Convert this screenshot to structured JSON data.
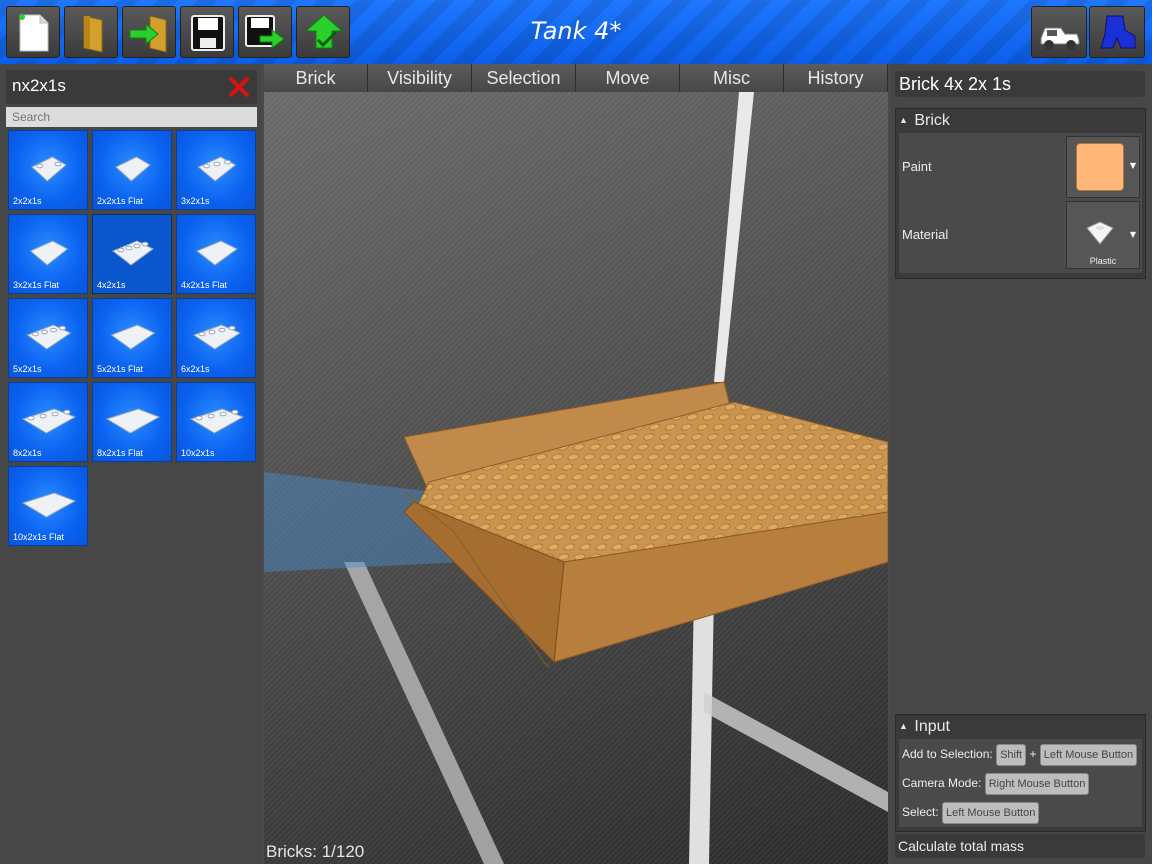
{
  "toolbar": {
    "title": "Tank 4*",
    "left_buttons": [
      "new-file-icon",
      "open-folder-icon",
      "import-icon",
      "save-icon",
      "save-as-icon",
      "upload-icon"
    ],
    "right_buttons": [
      "vehicle-icon",
      "character-icon"
    ]
  },
  "library": {
    "filter_text": "nx2x1s",
    "search_placeholder": "Search",
    "tiles": [
      {
        "label": "2x2x1s"
      },
      {
        "label": "2x2x1s Flat"
      },
      {
        "label": "3x2x1s"
      },
      {
        "label": "3x2x1s Flat"
      },
      {
        "label": "4x2x1s",
        "selected": true
      },
      {
        "label": "4x2x1s Flat"
      },
      {
        "label": "5x2x1s"
      },
      {
        "label": "5x2x1s Flat"
      },
      {
        "label": "6x2x1s"
      },
      {
        "label": "8x2x1s"
      },
      {
        "label": "8x2x1s Flat"
      },
      {
        "label": "10x2x1s"
      },
      {
        "label": "10x2x1s Flat"
      }
    ]
  },
  "menu": {
    "items": [
      "Brick",
      "Visibility",
      "Selection",
      "Move",
      "Misc",
      "History"
    ]
  },
  "viewport": {
    "brick_count_label": "Bricks: 1/120"
  },
  "inspector": {
    "selected_brick": "Brick 4x 2x 1s",
    "brick_section": {
      "title": "Brick",
      "paint_label": "Paint",
      "paint_color": "#ffb877",
      "material_label": "Material",
      "material_value": "Plastic"
    },
    "input_section": {
      "title": "Input",
      "add_to_selection_label": "Add to Selection:",
      "shift_key": "Shift",
      "plus": "+",
      "left_mouse": "Left Mouse Button",
      "camera_mode_label": "Camera Mode:",
      "right_mouse": "Right Mouse Button",
      "select_label": "Select:",
      "select_key": "Left Mouse Button"
    },
    "calculate_mass": "Calculate total mass"
  },
  "colors": {
    "accent_blue": "#0a62f0",
    "brick_tan": "#c8904a"
  }
}
